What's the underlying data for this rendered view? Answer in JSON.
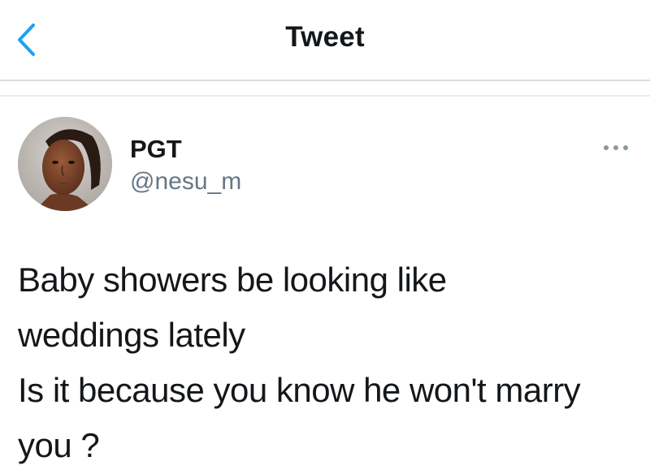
{
  "nav": {
    "title": "Tweet",
    "back_icon": "chevron-left-icon",
    "accent_color": "#1da1f2"
  },
  "tweet": {
    "author": {
      "name": "PGT",
      "handle": "@nesu_m",
      "avatar_icon": "profile-photo"
    },
    "more_icon": "more-horizontal-icon",
    "text_lines": [
      "Baby showers be looking like",
      "weddings lately",
      "Is it because you know he won't marry",
      "you ?"
    ]
  }
}
